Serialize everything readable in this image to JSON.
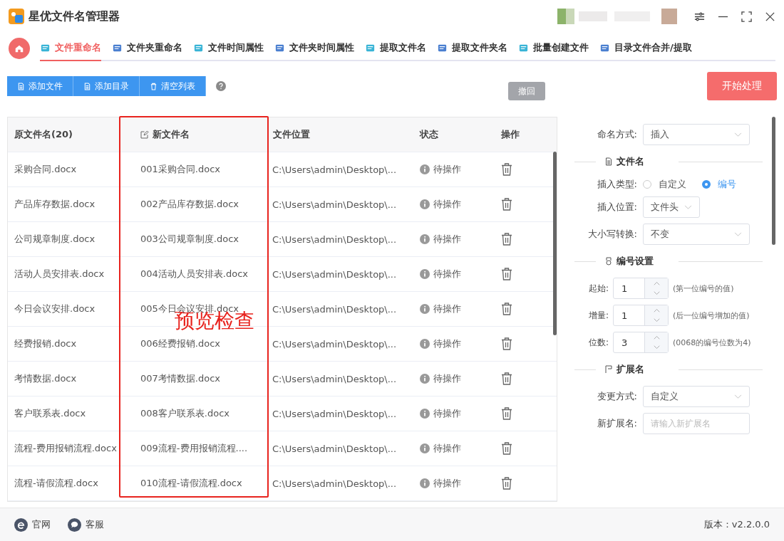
{
  "window": {
    "title": "星优文件名管理器"
  },
  "nav_tabs": [
    {
      "label": "文件重命名",
      "selected": true
    },
    {
      "label": "文件夹重命名",
      "selected": false
    },
    {
      "label": "文件时间属性",
      "selected": false
    },
    {
      "label": "文件夹时间属性",
      "selected": false
    },
    {
      "label": "提取文件名",
      "selected": false
    },
    {
      "label": "提取文件夹名",
      "selected": false
    },
    {
      "label": "批量创建文件",
      "selected": false
    },
    {
      "label": "目录文件合并/提取",
      "selected": false
    }
  ],
  "toolbar": {
    "buttons": [
      {
        "label": "添加文件",
        "kind": "file"
      },
      {
        "label": "添加目录",
        "kind": "folder"
      },
      {
        "label": "清空列表",
        "kind": "clear"
      }
    ],
    "undo": {
      "label": "撤回",
      "disabled": true
    },
    "start": {
      "label": "开始处理"
    }
  },
  "table": {
    "columns": [
      "原文件名(20)",
      "新文件名",
      "文件位置",
      "状态",
      "操作"
    ],
    "rows": [
      {
        "original": "采购合同.docx",
        "new_name": "001采购合同.docx",
        "location": "C:\\Users\\admin\\Desktop\\...",
        "status": "待操作"
      },
      {
        "original": "产品库存数据.docx",
        "new_name": "002产品库存数据.docx",
        "location": "C:\\Users\\admin\\Desktop\\...",
        "status": "待操作"
      },
      {
        "original": "公司规章制度.docx",
        "new_name": "003公司规章制度.docx",
        "location": "C:\\Users\\admin\\Desktop\\...",
        "status": "待操作"
      },
      {
        "original": "活动人员安排表.docx",
        "new_name": "004活动人员安排表.docx",
        "location": "C:\\Users\\admin\\Desktop\\...",
        "status": "待操作"
      },
      {
        "original": "今日会议安排.docx",
        "new_name": "005今日会议安排.docx",
        "location": "C:\\Users\\admin\\Desktop\\...",
        "status": "待操作"
      },
      {
        "original": "经费报销.docx",
        "new_name": "006经费报销.docx",
        "location": "C:\\Users\\admin\\Desktop\\...",
        "status": "待操作"
      },
      {
        "original": "考情数据.docx",
        "new_name": "007考情数据.docx",
        "location": "C:\\Users\\admin\\Desktop\\...",
        "status": "待操作"
      },
      {
        "original": "客户联系表.docx",
        "new_name": "008客户联系表.docx",
        "location": "C:\\Users\\admin\\Desktop\\...",
        "status": "待操作"
      },
      {
        "original": "流程-费用报销流程.docx",
        "new_name": "009流程-费用报销流程....",
        "location": "C:\\Users\\admin\\Desktop\\...",
        "status": "待操作"
      },
      {
        "original": "流程-请假流程.docx",
        "new_name": "010流程-请假流程.docx",
        "location": "C:\\Users\\admin\\Desktop\\...",
        "status": "待操作"
      }
    ],
    "annotation": "预览检查"
  },
  "settings": {
    "naming_mode": {
      "label": "命名方式:",
      "value": "插入"
    },
    "filename_section": "文件名",
    "insert_type": {
      "label": "插入类型:",
      "options": [
        {
          "label": "自定义",
          "selected": false
        },
        {
          "label": "编号",
          "selected": true
        }
      ]
    },
    "insert_position": {
      "label": "插入位置:",
      "value": "文件头"
    },
    "case_conversion": {
      "label": "大小写转换:",
      "value": "不变"
    },
    "numbering_section": "编号设置",
    "numbering": [
      {
        "label": "起始:",
        "value": "1",
        "hint": "(第一位编号的值)"
      },
      {
        "label": "增量:",
        "value": "1",
        "hint": "(后一位编号增加的值)"
      },
      {
        "label": "位数:",
        "value": "3",
        "hint": "(0068的编号位数为4)"
      }
    ],
    "extension_section": "扩展名",
    "change_mode": {
      "label": "变更方式:",
      "value": "自定义"
    },
    "new_extension": {
      "label": "新扩展名:",
      "placeholder": "请输入新扩展名"
    }
  },
  "footer": {
    "links": [
      {
        "label": "官网",
        "kind": "web"
      },
      {
        "label": "客服",
        "kind": "chat"
      }
    ],
    "version": "版本：v2.2.0.0"
  }
}
